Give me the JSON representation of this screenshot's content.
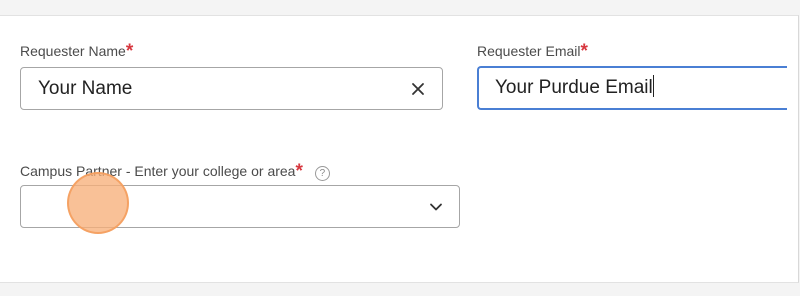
{
  "form": {
    "requester_name": {
      "label": "Requester Name",
      "required_mark": "*",
      "value": "Your Name",
      "clear_icon": "close-icon"
    },
    "requester_email": {
      "label": "Requester Email",
      "required_mark": "*",
      "value": "Your Purdue Email",
      "focused": true
    },
    "campus_partner": {
      "label": "Campus Partner - Enter your college or area",
      "required_mark": "*",
      "help_glyph": "?",
      "value": "",
      "dropdown_icon": "chevron-down-icon"
    }
  },
  "colors": {
    "required": "#d7373f",
    "focus_border": "#4a7fd4",
    "click_marker": "#f7af7a"
  }
}
